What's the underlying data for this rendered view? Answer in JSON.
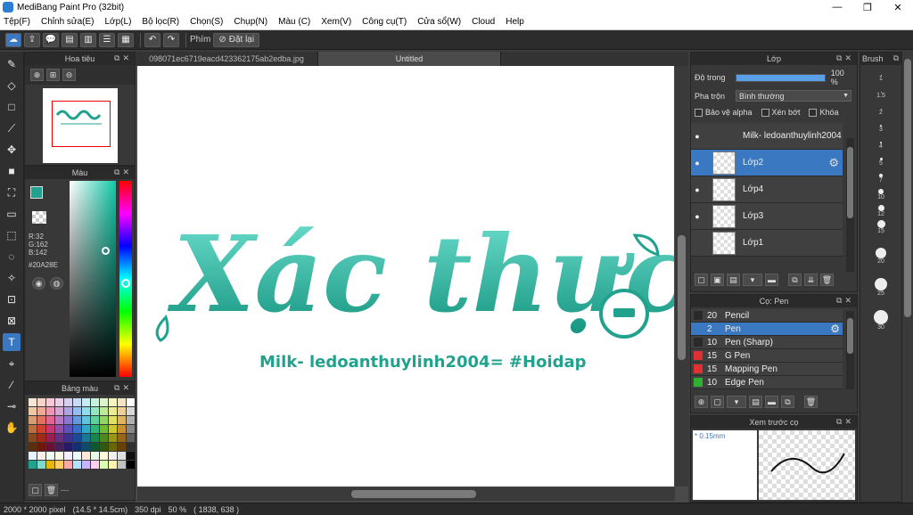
{
  "titlebar": {
    "title": "MediBang Paint Pro (32bit)",
    "min": "—",
    "max": "❐",
    "close": "✕"
  },
  "menu": [
    "Tệp(F)",
    "Chỉnh sửa(E)",
    "Lớp(L)",
    "Bộ lọc(R)",
    "Chọn(S)",
    "Chụp(N)",
    "Màu (C)",
    "Xem(V)",
    "Công cụ(T)",
    "Cửa sổ(W)",
    "Cloud",
    "Help"
  ],
  "toolbar": {
    "phim_label": "Phím",
    "reset_label": "Đặt lại"
  },
  "tabs": [
    "098071ec6719eacd423362175ab2edba.jpg",
    "Untitled"
  ],
  "navigator": {
    "title": "Hoa tiêu"
  },
  "color": {
    "title": "Màu",
    "r": "R:32",
    "g": "G:162",
    "b": "B:142",
    "hex": "#20A28E",
    "swatch": "#20a28e"
  },
  "palette": {
    "title": "Bảng màu",
    "footer": "---"
  },
  "canvas": {
    "title_art": "Xác thực",
    "subtitle": "Milk- ledoanthuylinh2004= #Hoidap",
    "teal": "#20a28e"
  },
  "layer_panel": {
    "title": "Lớp",
    "opacity_label": "Độ trong",
    "opacity_value": "100 %",
    "opacity_fill": 1.0,
    "blend_label": "Pha trộn",
    "blend_value": "Bình thường",
    "protect_alpha": "Bảo vệ alpha",
    "clip": "Xén bớt",
    "lock": "Khóa",
    "layers": [
      "Milk- ledoanthuylinh2004",
      "Lớp2",
      "Lớp4",
      "Lớp3",
      "Lớp1"
    ]
  },
  "brush_panel": {
    "title": "Cọ: Pen",
    "brushes": [
      {
        "size": "20",
        "name": "Pencil",
        "color": "#2a2a2a"
      },
      {
        "size": "2",
        "name": "Pen",
        "color": "#3a78c2"
      },
      {
        "size": "10",
        "name": "Pen (Sharp)",
        "color": "#2a2a2a"
      },
      {
        "size": "15",
        "name": "G Pen",
        "color": "#e03030"
      },
      {
        "size": "15",
        "name": "Mapping Pen",
        "color": "#e03030"
      },
      {
        "size": "10",
        "name": "Edge Pen",
        "color": "#30b030"
      }
    ]
  },
  "brush_preview": {
    "title": "Xem trước cọ",
    "size": "* 0.15mm"
  },
  "brush_size_panel": {
    "title": "Brush",
    "sizes": [
      "1",
      "1.5",
      "2",
      "3",
      "4",
      "5",
      "7",
      "10",
      "12",
      "15",
      "20",
      "25",
      "30"
    ]
  },
  "status": {
    "size": "2000 * 2000 pixel",
    "cm": "(14.5 * 14.5cm)",
    "dpi": "350 dpi",
    "zoom": "50 %",
    "coords": "( 1838, 638 )"
  }
}
